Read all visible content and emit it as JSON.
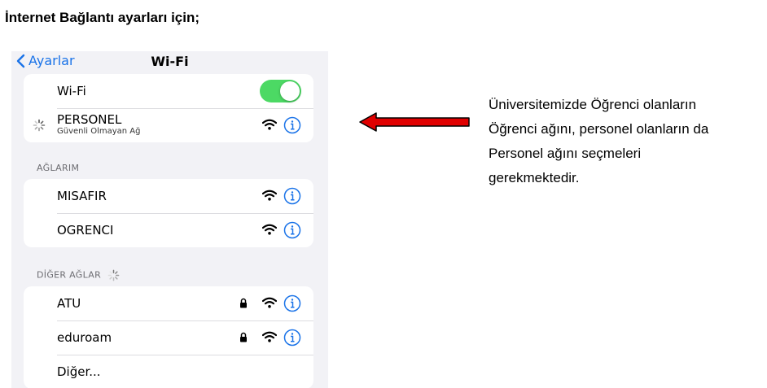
{
  "doc": {
    "heading": "İnternet Bağlantı ayarları için;"
  },
  "nav": {
    "back_label": "Ayarlar",
    "title": "Wi-Fi"
  },
  "wifi_toggle": {
    "label": "Wi-Fi",
    "on": true
  },
  "current_network": {
    "name": "PERSONEL",
    "subtitle": "Güvenli Olmayan Ağ"
  },
  "my_networks": {
    "header": "AĞLARIM",
    "items": [
      {
        "name": "MISAFIR"
      },
      {
        "name": "OGRENCI"
      }
    ]
  },
  "other_networks": {
    "header": "DİĞER AĞLAR",
    "items": [
      {
        "name": "ATU",
        "locked": true
      },
      {
        "name": "eduroam",
        "locked": true
      }
    ],
    "other_label": "Diğer..."
  },
  "note": {
    "lines": [
      "Üniversitemizde Öğrenci olanların",
      "Öğrenci ağını, personel olanların da",
      "Personel ağını seçmeleri",
      "gerekmektedir."
    ]
  },
  "icons": {
    "wifi": "wifi-icon",
    "info": "info-icon",
    "lock": "lock-icon",
    "spinner": "spinner-icon",
    "back": "chevron-left-icon"
  },
  "colors": {
    "accent": "#1a73e8",
    "toggle_on": "#4cd964",
    "arrow_fill": "#e00000"
  }
}
